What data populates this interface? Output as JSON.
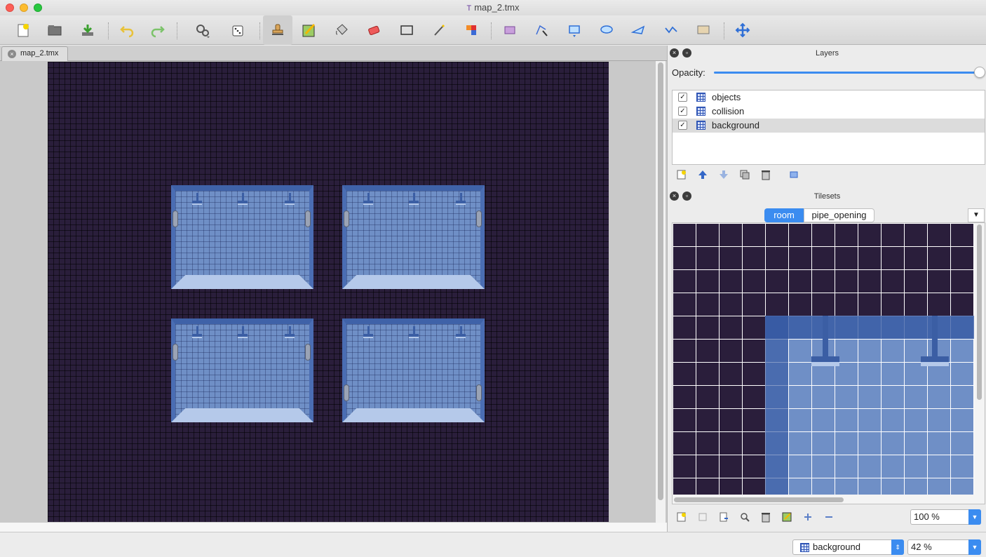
{
  "window": {
    "title": "map_2.tmx"
  },
  "document_tab": {
    "label": "map_2.tmx"
  },
  "layers_panel": {
    "title": "Layers",
    "opacity_label": "Opacity:",
    "opacity_value": 1.0,
    "layers": [
      {
        "name": "objects",
        "visible": true,
        "selected": false
      },
      {
        "name": "collision",
        "visible": true,
        "selected": false
      },
      {
        "name": "background",
        "visible": true,
        "selected": true
      }
    ]
  },
  "tilesets_panel": {
    "title": "Tilesets",
    "tabs": [
      {
        "label": "room",
        "active": true
      },
      {
        "label": "pipe_opening",
        "active": false
      }
    ],
    "zoom": "100 %"
  },
  "status_bar": {
    "current_layer": "background",
    "zoom": "42 %"
  },
  "colors": {
    "map_background": "#2a1e3b",
    "room_floor": "#6f8fc6",
    "accent": "#3b8cf0"
  }
}
